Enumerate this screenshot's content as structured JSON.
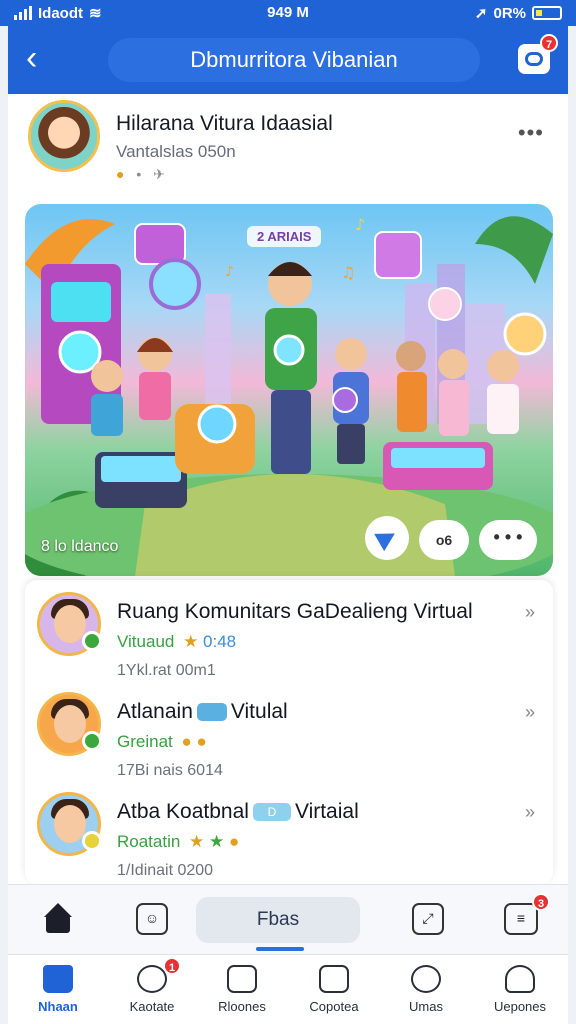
{
  "status_bar": {
    "carrier": "Idaodt",
    "time": "949 M",
    "battery": "0R%"
  },
  "header": {
    "title": "Dbmurritora Vibanian",
    "notification_count": "7"
  },
  "owner": {
    "name": "Hilarana Vitura Idaasial",
    "subtitle": "Vantalslas 050n"
  },
  "hero": {
    "tag": "2 ARIAIS",
    "caption": "8 lo ldanco",
    "pill_label": "o6",
    "more_label": "• • •"
  },
  "list": [
    {
      "title": "Ruang Komunitars GaDealieng Virtual",
      "subtitle": "Vituaud",
      "extra": "0:48",
      "meta": "1Ykl.rat 00m1"
    },
    {
      "title": "Atlanain",
      "title_tag": "",
      "title_suffix": "Vitulal",
      "subtitle": "Greinat",
      "meta": "17Bi nais 6014"
    },
    {
      "title": "Atba Koatbnal",
      "title_tag": "D",
      "title_suffix": "Virtaial",
      "subtitle": "Roatatin",
      "meta": "1/Idinait 0200"
    }
  ],
  "action_bar": {
    "pill_label": "Fbas",
    "right_badge": "3"
  },
  "bottom_nav": {
    "items": [
      {
        "label": "Nhaan",
        "badge": ""
      },
      {
        "label": "Kaotate",
        "badge": "1"
      },
      {
        "label": "Rloones",
        "badge": ""
      },
      {
        "label": "Copotea",
        "badge": ""
      },
      {
        "label": "Umas",
        "badge": ""
      },
      {
        "label": "Uepones",
        "badge": ""
      }
    ]
  },
  "colors": {
    "primary": "#1f63d6",
    "badge": "#e53232",
    "online": "#3aa83a",
    "subtitle_green": "#37a040"
  },
  "icons": [
    "back-arrow-icon",
    "chat-bubble-icon",
    "more-dots-icon",
    "share-send-icon",
    "chevron-right-icon",
    "home-icon",
    "chat-face-icon",
    "expand-icon",
    "message-icon",
    "calendar-icon",
    "printer-icon",
    "heart-icon",
    "user-icon"
  ]
}
